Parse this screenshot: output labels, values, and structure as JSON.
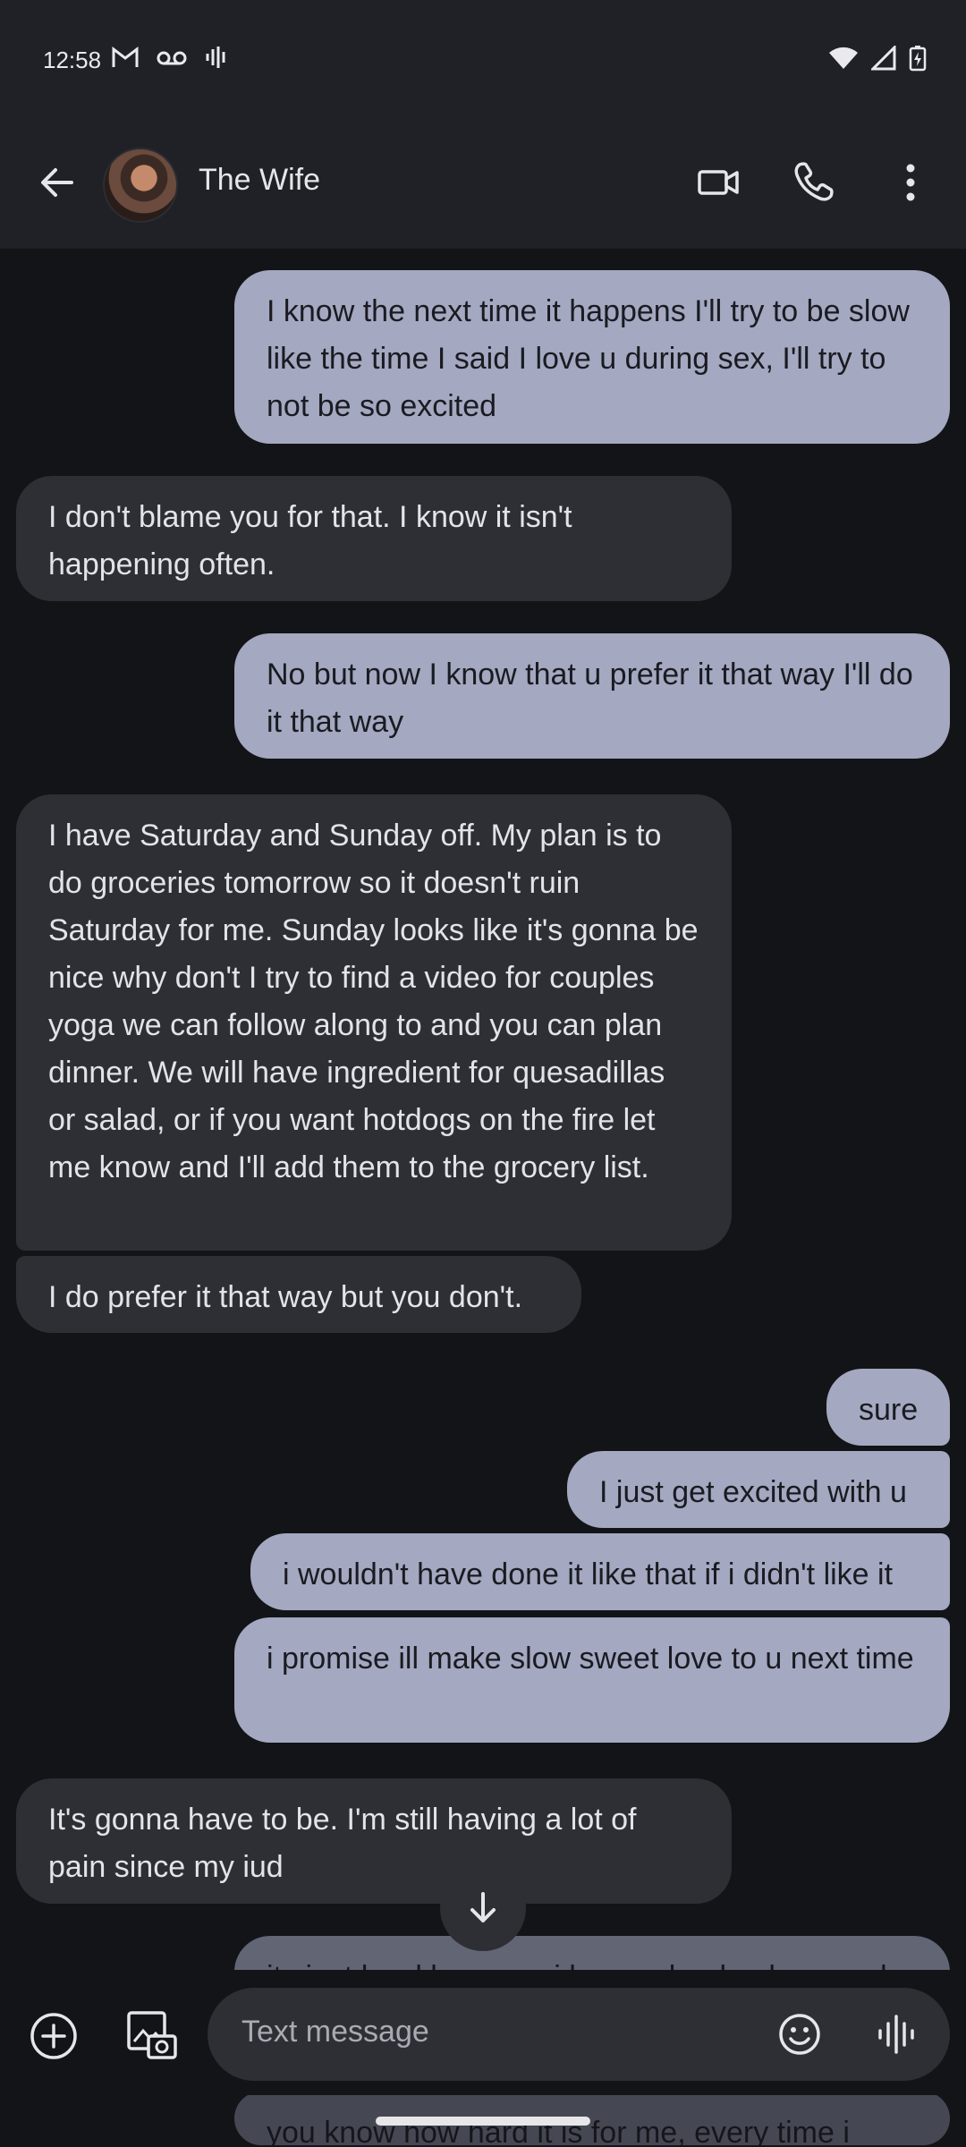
{
  "status_bar": {
    "time": "12:58",
    "left_icons": [
      "gmail-icon",
      "voicemail-icon",
      "audio-icon"
    ],
    "right_icons": [
      "wifi-icon",
      "signal-icon",
      "battery-charging-icon"
    ]
  },
  "header": {
    "contact_name": "The Wife",
    "actions": [
      "video-call-icon",
      "phone-icon",
      "more-vert-icon"
    ]
  },
  "messages": [
    {
      "dir": "out",
      "text": "I know the next time it happens I'll try to be slow like the time I said I love u during sex, I'll try to not be so excited"
    },
    {
      "dir": "in",
      "text": "I don't blame you for that. I know it isn't happening often."
    },
    {
      "dir": "out",
      "text": "No but now I know that u prefer it that way I'll do it that way"
    },
    {
      "dir": "in",
      "text": "I have Saturday and Sunday off. My plan is to do groceries tomorrow so it doesn't ruin Saturday for me. Sunday looks like it's gonna be nice why don't I try to find a video for couples yoga we can follow along to and you can plan dinner. We will have ingredient for quesadillas or salad, or if you want hotdogs on the fire let me know and I'll add them to the grocery list."
    },
    {
      "dir": "in",
      "text": "I do prefer it that way but you don't."
    },
    {
      "dir": "out",
      "text": "sure"
    },
    {
      "dir": "out",
      "text": "I just get excited with u"
    },
    {
      "dir": "out",
      "text": "i wouldn't have done it like that if i didn't like it"
    },
    {
      "dir": "out",
      "text": "i promise ill make slow sweet love to u next time"
    },
    {
      "dir": "in",
      "text": "It's gonna have to be. I'm still having a lot of pain since my iud"
    },
    {
      "dir": "out",
      "text": "its just hard because i love ur boobs, bum and"
    },
    {
      "dir": "out",
      "text": "you know how hard it is for me, every time i"
    }
  ],
  "compose": {
    "placeholder": "Text message",
    "icons": [
      "add-icon",
      "gallery-icon",
      "emoji-icon",
      "voice-icon"
    ]
  },
  "colors": {
    "background": "#131418",
    "bar": "#1f2126",
    "outgoing_bubble": "#a4a8c0",
    "incoming_bubble": "#2d2f35"
  }
}
